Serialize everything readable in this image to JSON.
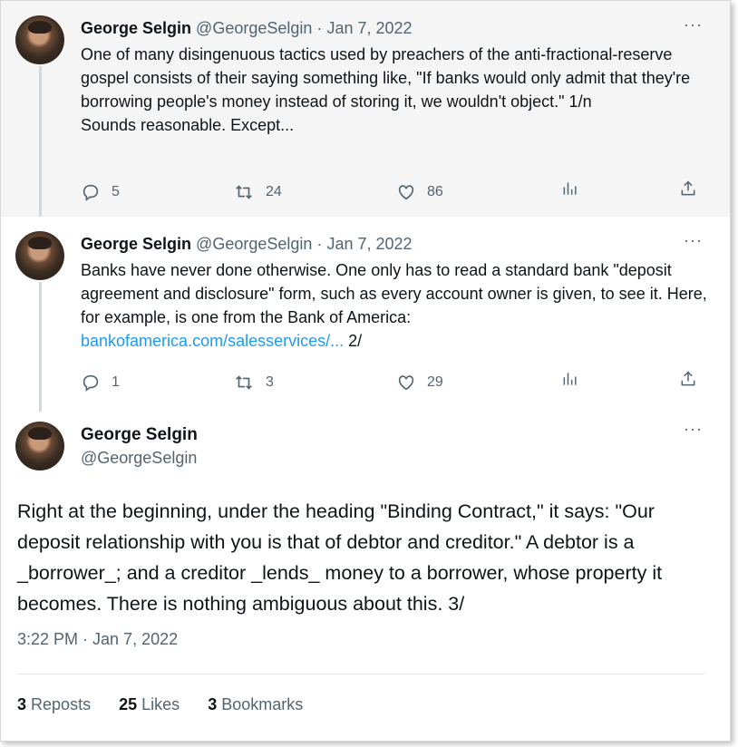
{
  "tweets": [
    {
      "author_name": "George Selgin",
      "handle": "@GeorgeSelgin",
      "separator": "·",
      "date": "Jan 7, 2022",
      "more": "···",
      "body": "One of many disingenuous tactics used by preachers of the anti-fractional-reserve gospel consists of their saying something like, \"If banks would only admit that they're  borrowing people's money instead of storing it, we wouldn't object.\" 1/n",
      "body_line2": "Sounds reasonable. Except...",
      "replies": "5",
      "reposts": "24",
      "likes": "86"
    },
    {
      "author_name": "George Selgin",
      "handle": "@GeorgeSelgin",
      "separator": "·",
      "date": "Jan 7, 2022",
      "more": "···",
      "body": "Banks have never done otherwise. One only has to read a standard bank \"deposit agreement and disclosure\" form, such as every account owner is given, to see it. Here, for example, is one from the Bank of America:",
      "link": "bankofamerica.com/salesservices/...",
      "body_suffix": " 2/",
      "replies": "1",
      "reposts": "3",
      "likes": "29"
    }
  ],
  "main_tweet": {
    "author_name": "George Selgin",
    "handle": "@GeorgeSelgin",
    "more": "···",
    "body": "Right at the beginning, under the heading \"Binding Contract,\" it says: \"Our deposit relationship with you is that of debtor and creditor.\" A debtor is a _borrower_; and a creditor _lends_ money to a borrower, whose property it becomes. There is nothing ambiguous about this. 3/",
    "timestamp": "3:22 PM · Jan 7, 2022",
    "stats": [
      {
        "num": "3",
        "label": "Reposts"
      },
      {
        "num": "25",
        "label": "Likes"
      },
      {
        "num": "3",
        "label": "Bookmarks"
      }
    ]
  },
  "icons": {
    "reply": "reply-icon",
    "repost": "repost-icon",
    "like": "heart-icon",
    "views": "views-icon",
    "share": "share-icon"
  },
  "colors": {
    "link": "#1d9bf0",
    "secondary_text": "#536471",
    "primary_text": "#0f1419",
    "highlight_bg": "#f5f5f5"
  }
}
